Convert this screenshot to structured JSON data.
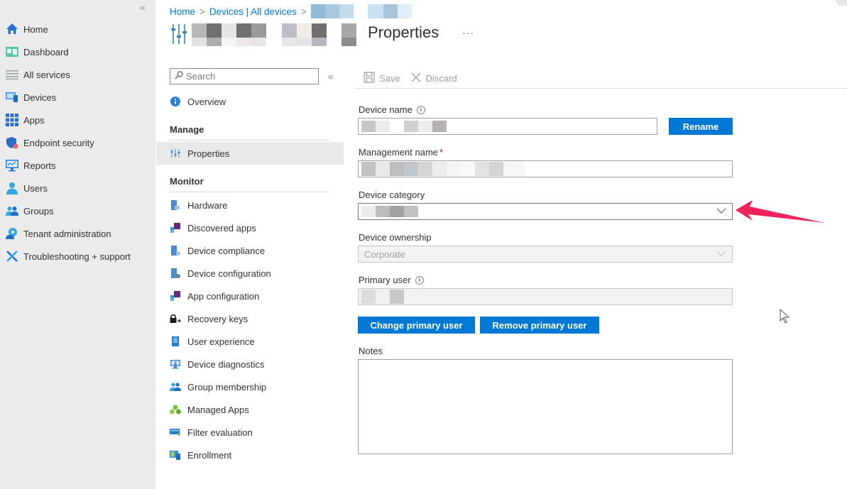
{
  "left_nav": {
    "collapse_label": "«",
    "items": [
      {
        "label": "Home",
        "icon": "home-icon"
      },
      {
        "label": "Dashboard",
        "icon": "dashboard-icon"
      },
      {
        "label": "All services",
        "icon": "list-icon"
      },
      {
        "label": "Devices",
        "icon": "devices-icon"
      },
      {
        "label": "Apps",
        "icon": "apps-grid-icon"
      },
      {
        "label": "Endpoint security",
        "icon": "shield-icon"
      },
      {
        "label": "Reports",
        "icon": "reports-icon"
      },
      {
        "label": "Users",
        "icon": "user-icon"
      },
      {
        "label": "Groups",
        "icon": "groups-icon"
      },
      {
        "label": "Tenant administration",
        "icon": "tenant-admin-icon"
      },
      {
        "label": "Troubleshooting + support",
        "icon": "tools-icon"
      }
    ]
  },
  "breadcrumb": {
    "items": [
      "Home",
      "Devices | All devices"
    ],
    "separator": ">"
  },
  "header": {
    "title": "Properties",
    "more_label": "···",
    "icon": "properties-sliders-icon"
  },
  "resource_menu": {
    "search_placeholder": "Search",
    "collapse_label": "«",
    "overview": "Overview",
    "sections": [
      {
        "header": "Manage",
        "items": [
          {
            "label": "Properties",
            "selected": true,
            "icon": "properties-sliders-icon"
          }
        ]
      },
      {
        "header": "Monitor",
        "items": [
          {
            "label": "Hardware",
            "icon": "hardware-icon"
          },
          {
            "label": "Discovered apps",
            "icon": "discovered-apps-icon"
          },
          {
            "label": "Device compliance",
            "icon": "device-compliance-icon"
          },
          {
            "label": "Device configuration",
            "icon": "device-configuration-icon"
          },
          {
            "label": "App configuration",
            "icon": "app-configuration-icon"
          },
          {
            "label": "Recovery keys",
            "icon": "lock-key-icon"
          },
          {
            "label": "User experience",
            "icon": "user-experience-icon"
          },
          {
            "label": "Device diagnostics",
            "icon": "diagnostics-icon"
          },
          {
            "label": "Group membership",
            "icon": "groups-icon"
          },
          {
            "label": "Managed Apps",
            "icon": "managed-apps-icon"
          },
          {
            "label": "Filter evaluation",
            "icon": "filter-icon"
          },
          {
            "label": "Enrollment",
            "icon": "enrollment-icon"
          }
        ]
      }
    ]
  },
  "command_bar": {
    "save_label": "Save",
    "discard_label": "Discard"
  },
  "form": {
    "device_name": {
      "label": "Device name",
      "value": "",
      "rename_label": "Rename"
    },
    "management_name": {
      "label": "Management name",
      "required_marker": "*",
      "value": ""
    },
    "device_category": {
      "label": "Device category",
      "value": ""
    },
    "device_ownership": {
      "label": "Device ownership",
      "value": "Corporate"
    },
    "primary_user": {
      "label": "Primary user",
      "value": "",
      "change_label": "Change primary user",
      "remove_label": "Remove primary user"
    },
    "notes": {
      "label": "Notes",
      "value": ""
    }
  },
  "colors": {
    "accent": "#0078d4",
    "annotation_arrow": "#f0245c",
    "nav_bg": "#ebebeb"
  }
}
